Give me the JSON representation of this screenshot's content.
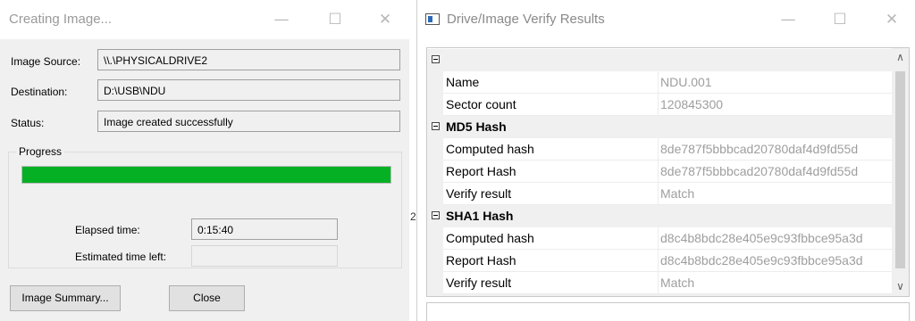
{
  "creating_window": {
    "title": "Creating Image...",
    "controls": {
      "minimize": "—",
      "maximize": "☐",
      "close": "✕"
    },
    "image_source_label": "Image Source:",
    "image_source_value": "\\\\.\\PHYSICALDRIVE2",
    "destination_label": "Destination:",
    "destination_value": "D:\\USB\\NDU",
    "status_label": "Status:",
    "status_value": "Image created successfully",
    "progress_label": "Progress",
    "progress_percent": 100,
    "elapsed_label": "Elapsed time:",
    "elapsed_value": "0:15:40",
    "estimated_label": "Estimated time left:",
    "estimated_value": "",
    "image_summary_button": "Image Summary...",
    "close_button": "Close"
  },
  "gap_text": "2",
  "verify_window": {
    "title": "Drive/Image Verify Results",
    "controls": {
      "minimize": "—",
      "maximize": "☐",
      "close": "✕"
    },
    "rows": [
      {
        "type": "category",
        "name": ""
      },
      {
        "type": "property",
        "name": "Name",
        "value": "NDU.001"
      },
      {
        "type": "property",
        "name": "Sector count",
        "value": "120845300"
      },
      {
        "type": "category",
        "name": "MD5 Hash"
      },
      {
        "type": "property",
        "name": "Computed hash",
        "value": "8de787f5bbbcad20780daf4d9fd55d"
      },
      {
        "type": "property",
        "name": "Report Hash",
        "value": "8de787f5bbbcad20780daf4d9fd55d"
      },
      {
        "type": "property",
        "name": "Verify result",
        "value": "Match"
      },
      {
        "type": "category",
        "name": "SHA1 Hash"
      },
      {
        "type": "property",
        "name": "Computed hash",
        "value": "d8c4b8bdc28e405e9c93fbbce95a3d"
      },
      {
        "type": "property",
        "name": "Report Hash",
        "value": "d8c4b8bdc28e405e9c93fbbce95a3d"
      },
      {
        "type": "property",
        "name": "Verify result",
        "value": "Match"
      },
      {
        "type": "category",
        "name": ""
      }
    ],
    "scroll_up": "∧",
    "scroll_down": "∨"
  }
}
